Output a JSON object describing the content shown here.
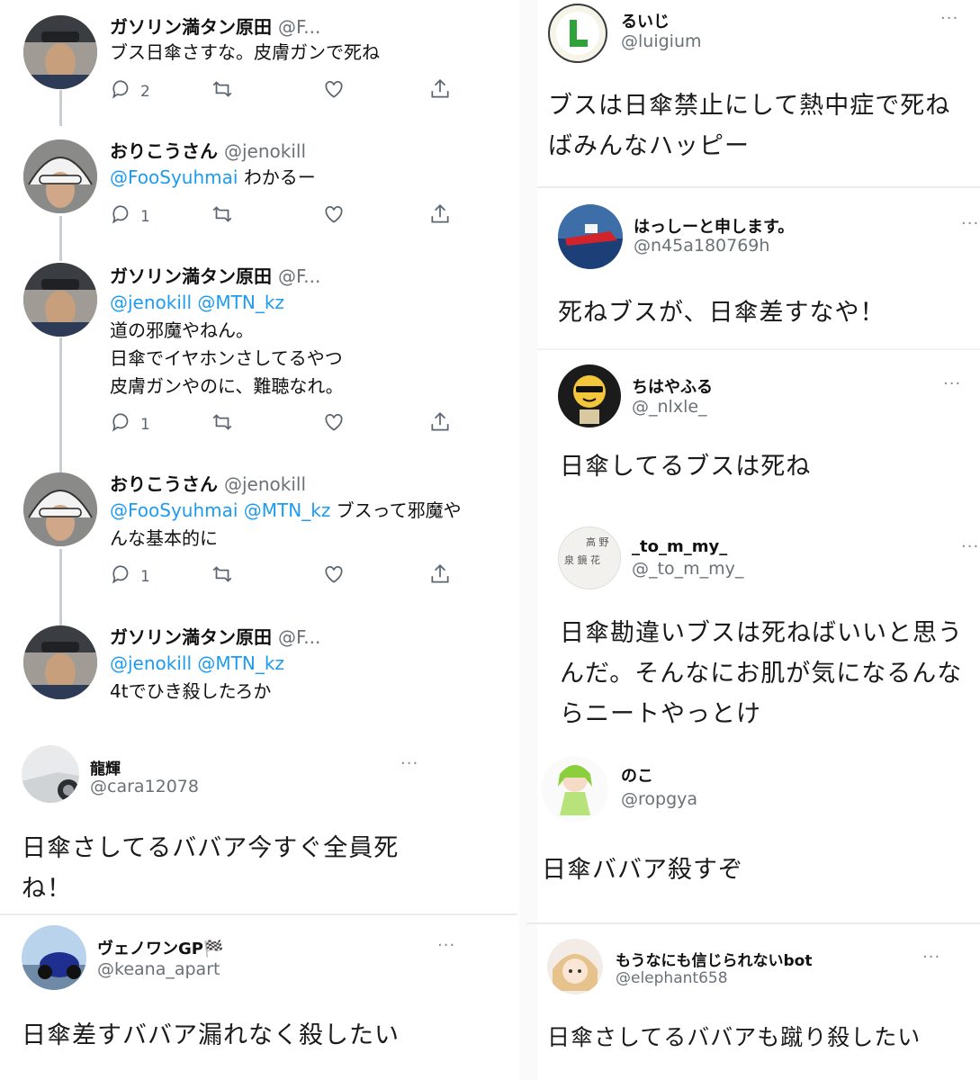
{
  "left_thread": [
    {
      "name": "ガソリン満タン原田",
      "handle": "@F...",
      "mentions": "",
      "text_lines": [
        "ブス日傘さすな。皮膚ガンで死ね"
      ],
      "reply_count": "2"
    },
    {
      "name": "おりこうさん",
      "handle": "@jenokill",
      "mentions": "@FooSyuhmai",
      "text_lines": [
        "わかるー"
      ],
      "reply_count": "1"
    },
    {
      "name": "ガソリン満タン原田",
      "handle": "@F...",
      "mentions": "@jenokill @MTN_kz",
      "text_lines": [
        "道の邪魔やねん。",
        "日傘でイヤホンさしてるやつ",
        "皮膚ガンやのに、難聴なれ。"
      ],
      "reply_count": "1"
    },
    {
      "name": "おりこうさん",
      "handle": "@jenokill",
      "mentions": "@FooSyuhmai @MTN_kz",
      "text_lines": [
        "ブスって邪魔や",
        "んな基本的に"
      ],
      "reply_count": "1"
    },
    {
      "name": "ガソリン満タン原田",
      "handle": "@F...",
      "mentions": "@jenokill @MTN_kz",
      "text_lines": [
        "4tでひき殺したろか"
      ]
    }
  ],
  "left_cards": [
    {
      "name": "龍輝",
      "handle": "@cara12078",
      "text_lines": [
        "日傘さしてるババア今すぐ全員死",
        "ね！"
      ]
    },
    {
      "name": "ヴェノワンGP🏁",
      "handle": "@keana_apart",
      "text_lines": [
        "日傘差すババア漏れなく殺したい"
      ]
    }
  ],
  "right_cards": [
    {
      "name": "るいじ",
      "handle": "@luigium",
      "text_lines": [
        "ブスは日傘禁止にして熱中症で死ね",
        "ばみんなハッピー"
      ]
    },
    {
      "name": "はっしーと申します。",
      "handle": "@n45a180769h",
      "text_lines": [
        "死ねブスが、日傘差すなや！"
      ]
    },
    {
      "name": "ちはやふる",
      "handle": "@_nlxle_",
      "text_lines": [
        "日傘してるブスは死ね"
      ]
    },
    {
      "name": "_to_m_my_",
      "handle": "@_to_m_my_",
      "text_lines": [
        "日傘勘違いブスは死ねばいいと思う",
        "んだ。そんなにお肌が気になるんな",
        "らニートやっとけ"
      ]
    },
    {
      "name": "のこ",
      "handle": "@ropgya",
      "text_lines": [
        "日傘ババア殺すぞ"
      ]
    },
    {
      "name": "もうなにも信じられないbot",
      "handle": "@elephant658",
      "text_lines": [
        "日傘さしてるババアも蹴り殺したい"
      ]
    }
  ],
  "icons": {
    "reply": "reply-icon",
    "retweet": "retweet-icon",
    "like": "like-icon",
    "share": "share-icon",
    "more": "more-dots-icon"
  },
  "more_label": "···",
  "colors": {
    "mention": "#1d9bf0",
    "meta": "#6b7177",
    "thread": "#c9ced3"
  }
}
